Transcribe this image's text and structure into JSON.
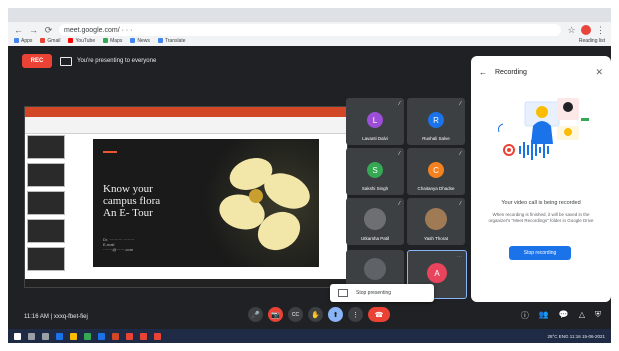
{
  "browser": {
    "url": "meet.google.com/  ·  ·  ·",
    "nav": [
      "←",
      "→",
      "⟳"
    ],
    "bookmarks": [
      {
        "label": "Apps",
        "color": "#4285f4"
      },
      {
        "label": "Gmail",
        "color": "#ea4335"
      },
      {
        "label": "YouTube",
        "color": "#ff0000"
      },
      {
        "label": "Maps",
        "color": "#34a853"
      },
      {
        "label": "News",
        "color": "#4285f4"
      },
      {
        "label": "Translate",
        "color": "#4285f4"
      }
    ],
    "reading_list": "Reading list"
  },
  "meet": {
    "rec_badge": "REC",
    "presenting_note": "You're presenting to everyone",
    "time": "11:16 AM",
    "meeting_code": "xxxq-fbet-fiej"
  },
  "slide": {
    "title": "Know your\ncampus flora\nAn E- Tour",
    "author": "Dr. ·········· ········\nE-mail\n·······@······.com"
  },
  "participants": [
    {
      "name": "Lavanti Dalvi",
      "initial": "L",
      "color": "#9c4fd6"
    },
    {
      "name": "Rushali Salve",
      "initial": "R",
      "color": "#1a73e8"
    },
    {
      "name": "Sakshi Singh",
      "initial": "S",
      "color": "#34a853"
    },
    {
      "name": "Chaitanya Dhadse",
      "initial": "C",
      "color": "#f4811f"
    },
    {
      "name": "Utkarsha Patil",
      "initial": "",
      "color": "#5f6368"
    },
    {
      "name": "Yash Thorat",
      "initial": "",
      "color": "#a07a55"
    },
    {
      "name": "",
      "initial": "",
      "color": "#5f6368"
    },
    {
      "name": "",
      "initial": "A",
      "color": "#e8455c"
    }
  ],
  "recording_panel": {
    "title": "Recording",
    "main_text": "Your video call is being recorded",
    "sub_text": "When recording is finished, it will be saved in the organizer's \"Meet Recordings\" folder in Google Drive",
    "button": "Stop recording"
  },
  "popup": {
    "label": "Stop presenting"
  },
  "controls": [
    "🎤",
    "📷",
    "CC",
    "✋",
    "⬆",
    "⋮"
  ],
  "taskbar": {
    "system_tray": "28°C  ENG  11:16  15-06-2021"
  },
  "colors": {
    "meet_bg": "#202124",
    "rec_red": "#ea4335",
    "primary_blue": "#1a73e8"
  }
}
